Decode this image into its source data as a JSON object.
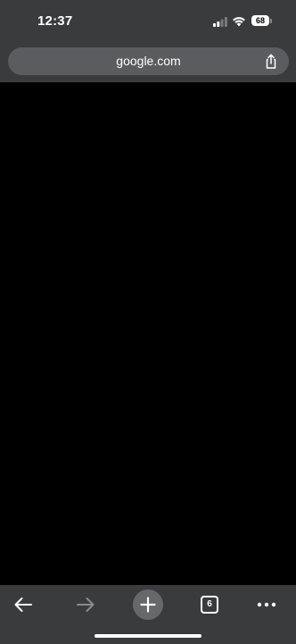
{
  "status_bar": {
    "time": "12:37",
    "battery_level": "68",
    "signal_icon": "cellular-signal-icon",
    "wifi_icon": "wifi-icon"
  },
  "address_bar": {
    "url": "google.com",
    "share_icon": "share-icon"
  },
  "toolbar": {
    "back_icon": "arrow-left-icon",
    "forward_icon": "arrow-right-icon",
    "new_tab_icon": "plus-icon",
    "tab_count": "6",
    "more_icon": "more-dots-icon"
  },
  "colors": {
    "chrome_background": "#3a3b3d",
    "address_bar_background": "#5a5c5f",
    "content_background": "#000000",
    "disabled_icon": "#8a8b8d"
  }
}
